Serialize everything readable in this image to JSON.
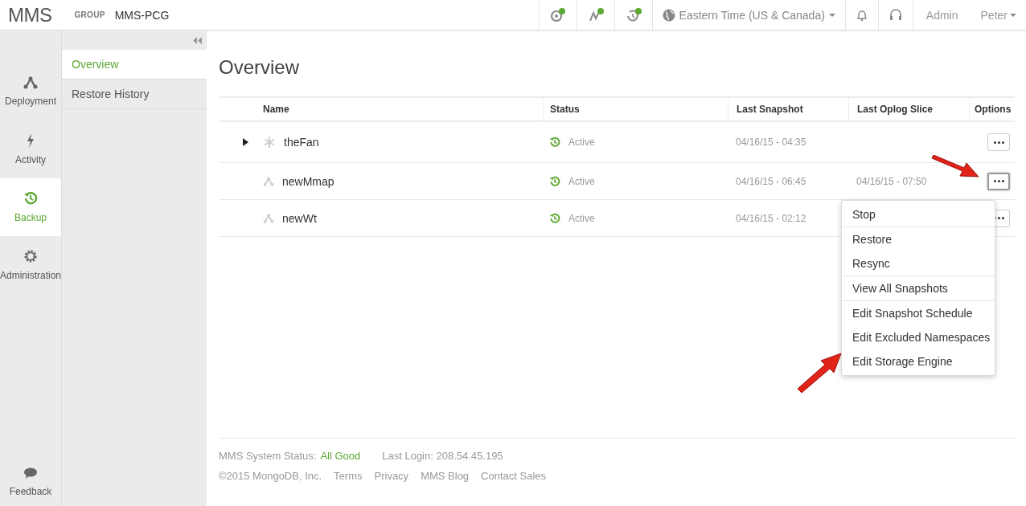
{
  "topbar": {
    "logo": "MMS",
    "group_label": "GROUP",
    "group_name": "MMS-PCG",
    "timezone": "Eastern Time (US & Canada)",
    "admin": "Admin",
    "user": "Peter"
  },
  "rail": [
    {
      "label": "Deployment",
      "kind": "deployment",
      "selected": false
    },
    {
      "label": "Activity",
      "kind": "activity",
      "selected": false
    },
    {
      "label": "Backup",
      "kind": "backup",
      "selected": true
    },
    {
      "label": "Administration",
      "kind": "admin",
      "selected": false
    }
  ],
  "feedback": "Feedback",
  "subnav": [
    {
      "label": "Overview",
      "selected": true
    },
    {
      "label": "Restore History",
      "selected": false
    }
  ],
  "page_title": "Overview",
  "table": {
    "columns": [
      "Name",
      "Status",
      "Last Snapshot",
      "Last Oplog Slice",
      "Options"
    ],
    "rows": [
      {
        "expandable": true,
        "kind": "cluster",
        "name": "theFan",
        "status": "Active",
        "last_snapshot": "04/16/15 - 04:35",
        "last_oplog": null,
        "menu_open": false
      },
      {
        "expandable": false,
        "kind": "replica",
        "name": "newMmap",
        "status": "Active",
        "last_snapshot": "04/16/15 - 06:45",
        "last_oplog": "04/16/15 - 07:50",
        "menu_open": true
      },
      {
        "expandable": false,
        "kind": "replica",
        "name": "newWt",
        "status": "Active",
        "last_snapshot": "04/16/15 - 02:12",
        "last_oplog": null,
        "menu_open": false
      }
    ]
  },
  "menu": {
    "groups": [
      [
        "Stop"
      ],
      [
        "Restore",
        "Resync"
      ],
      [
        "View All Snapshots"
      ],
      [
        "Edit Snapshot Schedule",
        "Edit Excluded Namespaces",
        "Edit Storage Engine"
      ]
    ]
  },
  "footer": {
    "status_label": "MMS System Status:",
    "status_value": "All Good",
    "last_login": "Last Login: 208.54.45.195",
    "copyright": "©2015 MongoDB, Inc.",
    "links": [
      "Terms",
      "Privacy",
      "MMS Blog",
      "Contact Sales"
    ]
  }
}
